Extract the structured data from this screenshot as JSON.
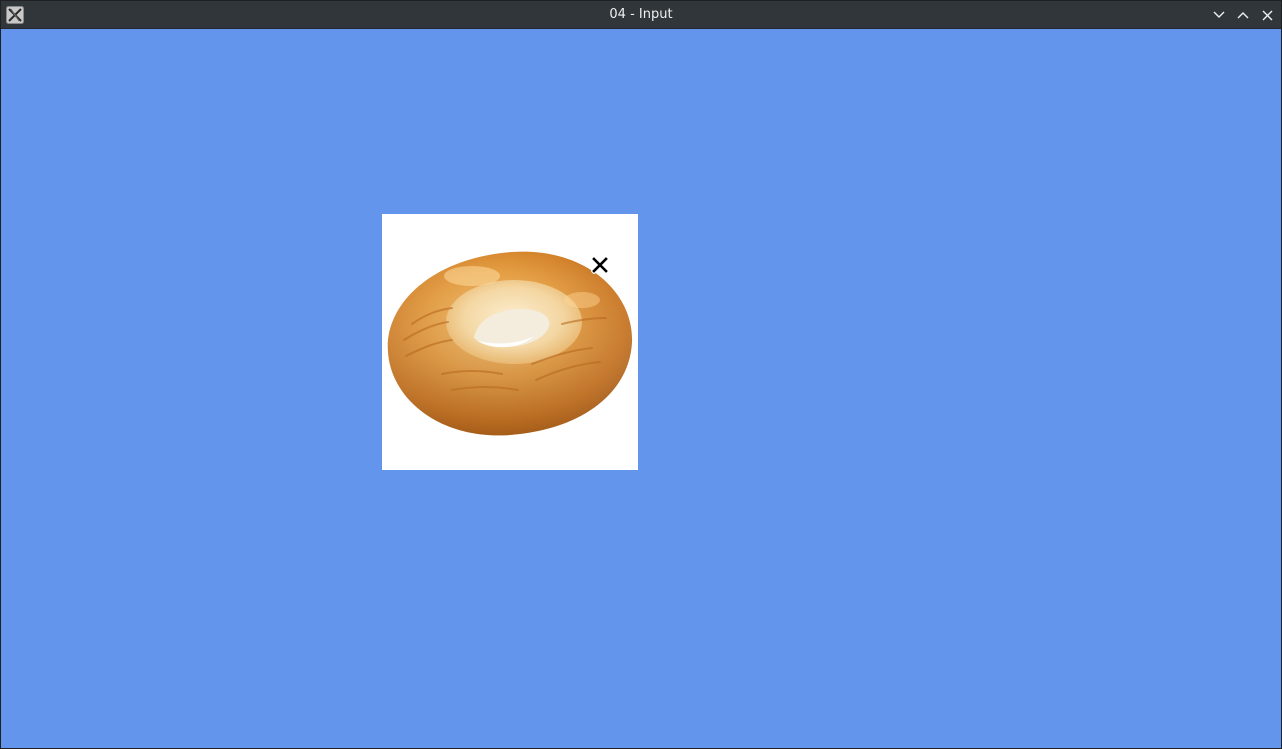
{
  "window": {
    "title": "04 - Input",
    "app_icon": "x11-app-icon",
    "controls": {
      "minimize_icon": "chevron-down-icon",
      "maximize_icon": "chevron-up-icon",
      "close_icon": "close-icon"
    }
  },
  "canvas": {
    "background_color": "#6495ed",
    "sprite": {
      "name": "bagel",
      "background_color": "#ffffff"
    },
    "cursor": {
      "icon": "x-cursor-icon",
      "color": "#000000"
    }
  }
}
